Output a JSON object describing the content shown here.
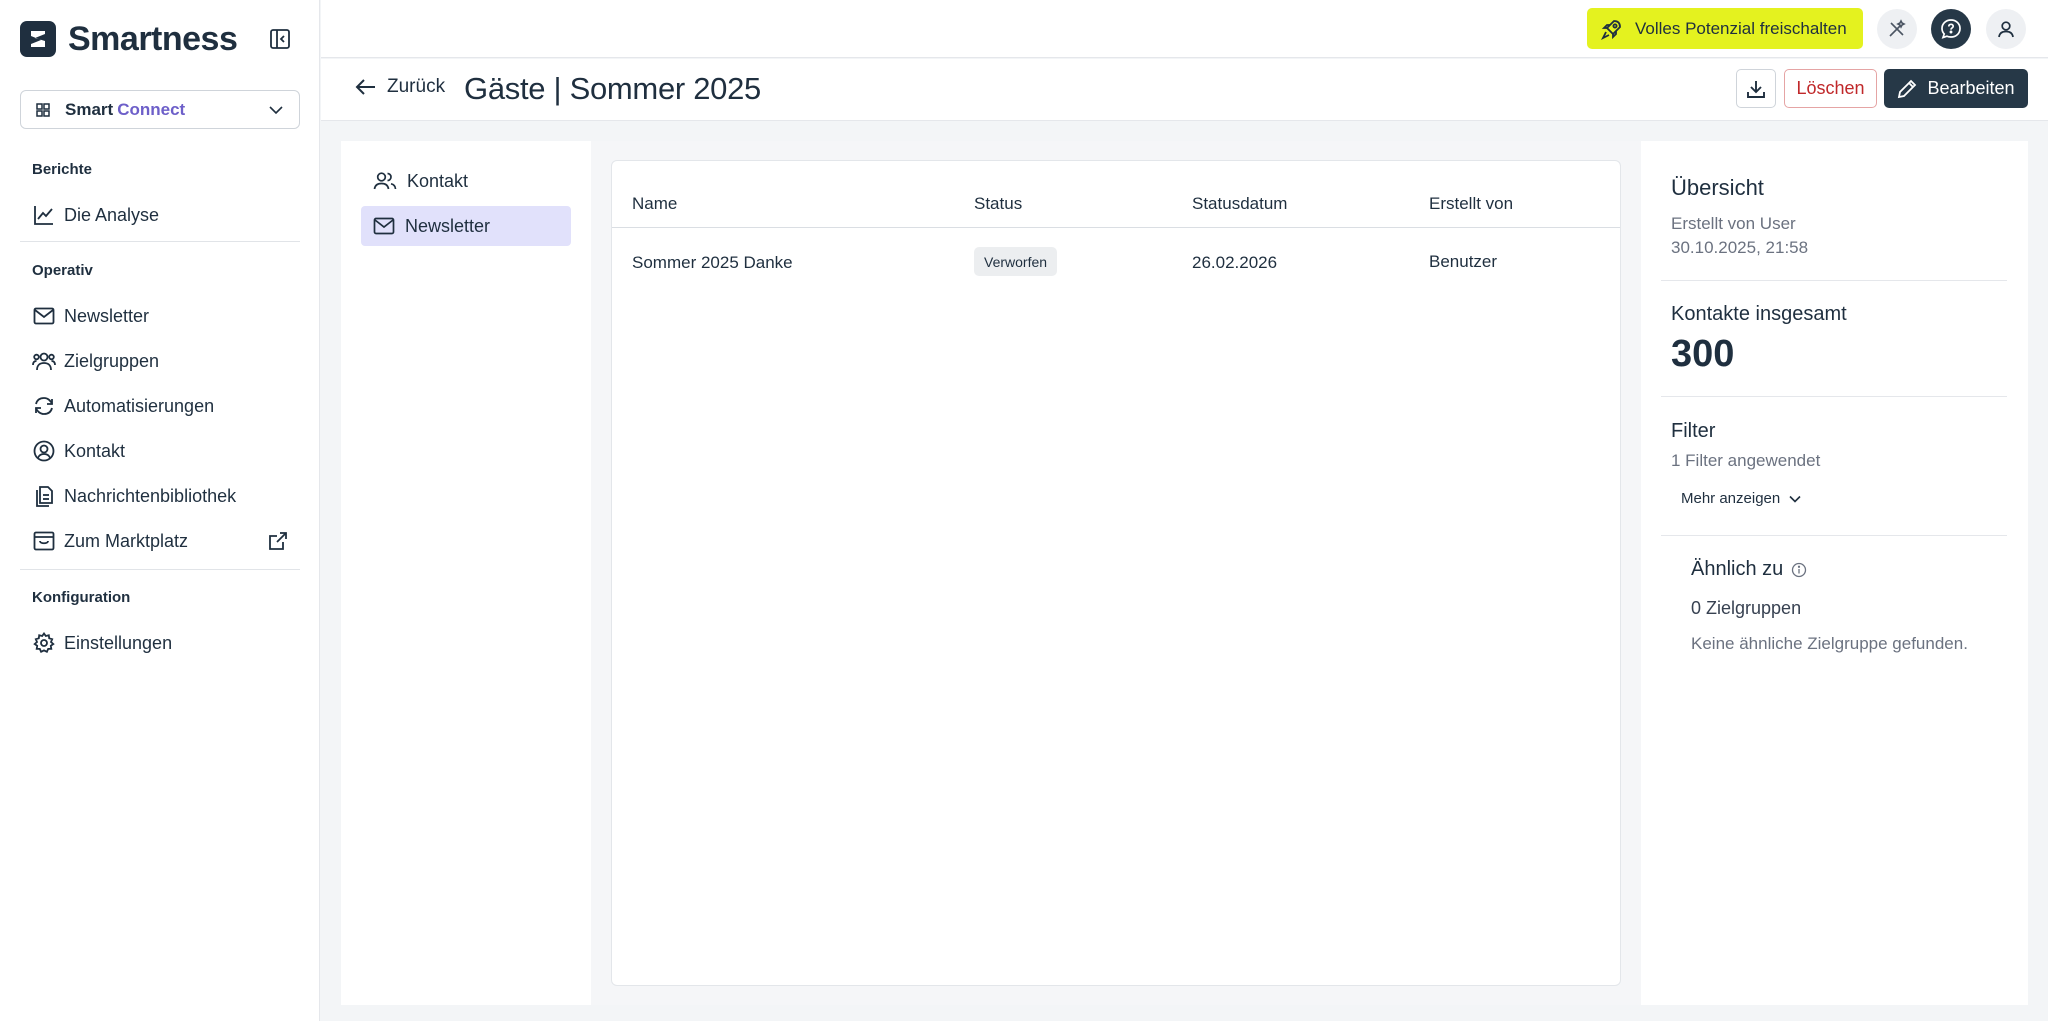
{
  "brand": {
    "name": "Smartness"
  },
  "app_switcher": {
    "name_part1": "Smart",
    "name_part2": "Connect"
  },
  "sidebar": {
    "sections": [
      {
        "label": "Berichte"
      },
      {
        "label": "Operativ"
      },
      {
        "label": "Konfiguration"
      }
    ],
    "items": [
      {
        "label": "Die Analyse",
        "icon": "chart-line-icon"
      },
      {
        "label": "Newsletter",
        "icon": "mail-icon"
      },
      {
        "label": "Zielgruppen",
        "icon": "users-icon"
      },
      {
        "label": "Automatisierungen",
        "icon": "refresh-icon"
      },
      {
        "label": "Kontakt",
        "icon": "user-circle-icon"
      },
      {
        "label": "Nachrichtenbibliothek",
        "icon": "documents-icon"
      },
      {
        "label": "Zum Marktplatz",
        "icon": "store-icon"
      },
      {
        "label": "Einstellungen",
        "icon": "gear-icon"
      }
    ]
  },
  "topbar": {
    "upgrade_label": "Volles Potenzial freischalten"
  },
  "header": {
    "back_label": "Zurück",
    "title": "Gäste | Sommer 2025",
    "delete_label": "Löschen",
    "edit_label": "Bearbeiten"
  },
  "tabs": [
    {
      "label": "Kontakt",
      "active": false
    },
    {
      "label": "Newsletter",
      "active": true
    }
  ],
  "table": {
    "columns": [
      "Name",
      "Status",
      "Statusdatum",
      "Erstellt von"
    ],
    "rows": [
      {
        "name": "Sommer 2025 Danke",
        "status": "Verworfen",
        "status_date": "26.02.2026",
        "created_by": "Benutzer"
      }
    ]
  },
  "overview": {
    "title": "Übersicht",
    "created_by": "Erstellt von User",
    "created_at": "30.10.2025, 21:58",
    "contacts_label": "Kontakte insgesamt",
    "contacts_count": "300",
    "filter_title": "Filter",
    "filter_summary": "1 Filter angewendet",
    "more_label": "Mehr anzeigen",
    "similar_title": "Ähnlich zu",
    "similar_count": "0 Zielgruppen",
    "similar_empty": "Keine ähnliche Zielgruppe gefunden."
  },
  "colors": {
    "brand_dark": "#1f2f3f",
    "accent_purple": "#6d5fc9",
    "upgrade_yellow": "#e4f21f",
    "danger": "#c0282a",
    "active_tab": "#e1e1fb"
  }
}
